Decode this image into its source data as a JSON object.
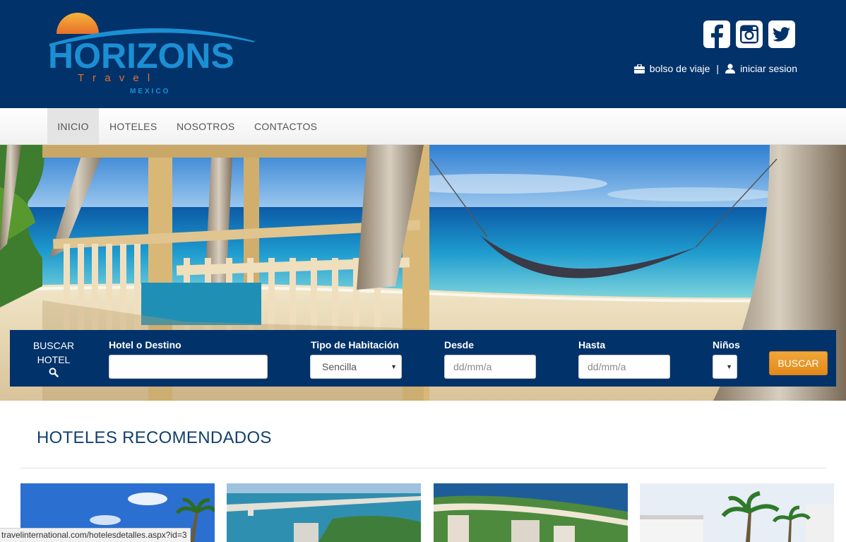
{
  "brand": {
    "logo_text": "HORIZONS",
    "logo_sub": "T r a v e l",
    "logo_country": "MEXICO",
    "colors": {
      "navy": "#02326a",
      "logo_blue": "#1c8fd4",
      "orange": "#f0a73a"
    }
  },
  "social": [
    {
      "name": "facebook-icon",
      "label": "f"
    },
    {
      "name": "instagram-icon"
    },
    {
      "name": "twitter-icon"
    }
  ],
  "user_links": {
    "bag": "bolso de viaje",
    "separator": "|",
    "login": "iniciar sesion"
  },
  "nav": [
    "INICIO",
    "HOTELES",
    "NOSOTROS",
    "CONTACTOS"
  ],
  "search": {
    "title_line1": "BUSCAR",
    "title_line2": "HOTEL",
    "destination_label": "Hotel o Destino",
    "room_label": "Tipo de Habitación",
    "room_value": "Sencilla",
    "from_label": "Desde",
    "from_placeholder": "dd/mm/a",
    "to_label": "Hasta",
    "to_placeholder": "dd/mm/a",
    "kids_label": "Niños",
    "button": "BUSCAR"
  },
  "recommended": {
    "title": "HOTELES RECOMENDADOS"
  },
  "status_url": "travelinternational.com/hotelesdetalles.aspx?id=3"
}
